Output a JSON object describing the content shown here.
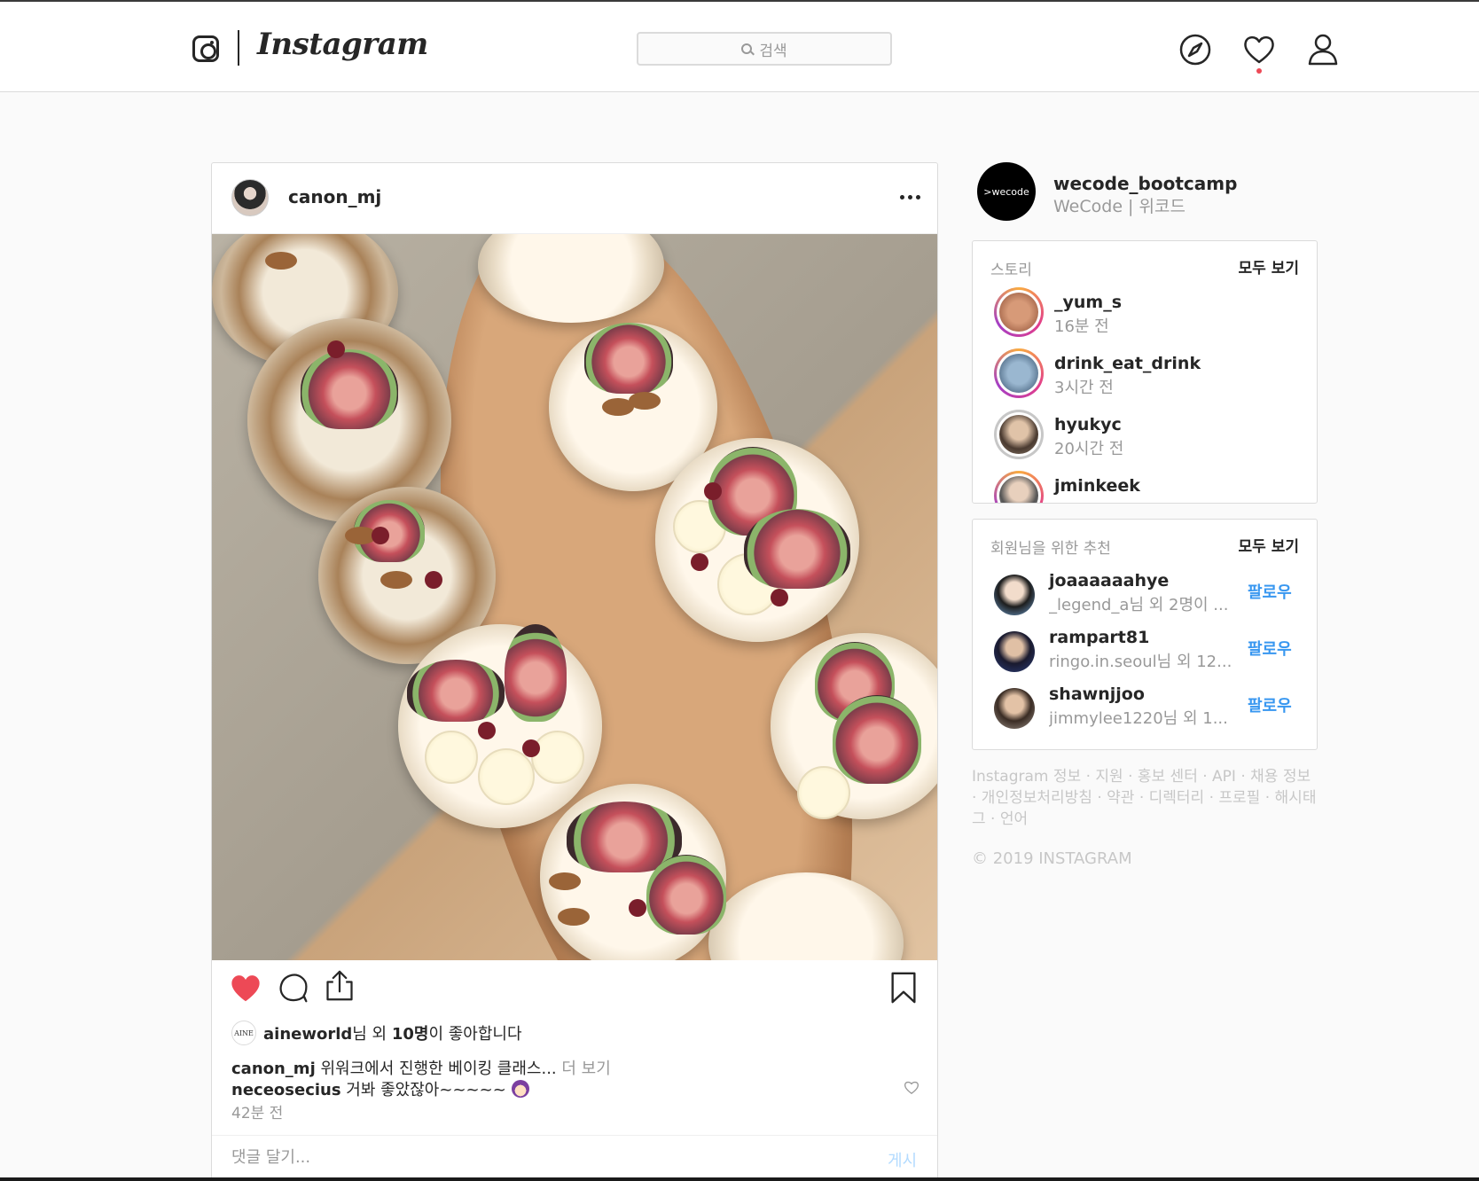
{
  "header": {
    "logo_text": "Instagram",
    "search_placeholder": "검색",
    "notification_color": "#ed4956"
  },
  "post": {
    "username": "canon_mj",
    "more_icon": "ellipsis-icon",
    "liked": true,
    "likes": {
      "avatar_text": "AINE",
      "first_liker": "aineworld",
      "suffix_a": "님 외 ",
      "count": "10명",
      "suffix_b": "이 좋아합니다"
    },
    "caption": {
      "username": "canon_mj",
      "text": " 위워크에서 진행한 베이킹 클래스...",
      "more": " 더 보기"
    },
    "comment": {
      "username": "neceosecius",
      "text": " 거봐 좋았잖아~~~~~"
    },
    "time": "42분 전",
    "comment_placeholder": "댓글 달기...",
    "post_button": "게시"
  },
  "sidebar": {
    "me": {
      "avatar_text": ">wecode",
      "handle": "wecode_bootcamp",
      "name": "WeCode | 위코드"
    },
    "stories": {
      "title": "스토리",
      "view_all": "모두 보기",
      "items": [
        {
          "handle": "_yum_s",
          "time": "16분 전",
          "color": "#b86b4b"
        },
        {
          "handle": "drink_eat_drink",
          "time": "3시간 전",
          "color": "#3b5a7a"
        },
        {
          "handle": "hyukyc",
          "time": "20시간 전",
          "color": "#6e5a4b"
        },
        {
          "handle": "jminkeek",
          "time": "",
          "color": "#7a7a7a"
        }
      ]
    },
    "suggestions": {
      "title": "회원님을 위한 추천",
      "view_all": "모두 보기",
      "items": [
        {
          "handle": "joaaaaaahye",
          "sub": "_legend_a님 외 2명이 ...",
          "follow": "팔로우",
          "color": "#3f6f9f"
        },
        {
          "handle": "rampart81",
          "sub": "ringo.in.seoul님 외 12...",
          "follow": "팔로우",
          "color": "#1f2a55"
        },
        {
          "handle": "shawnjjoo",
          "sub": "jimmylee1220님 외 1...",
          "follow": "팔로우",
          "color": "#4a3a30"
        }
      ]
    },
    "footer_links": "Instagram 정보 · 지원 · 홍보 센터 · API · 채용 정보 · 개인정보처리방침 · 약관 · 디렉터리 · 프로필 · 해시태그 · 언어",
    "copyright": "© 2019 INSTAGRAM"
  }
}
